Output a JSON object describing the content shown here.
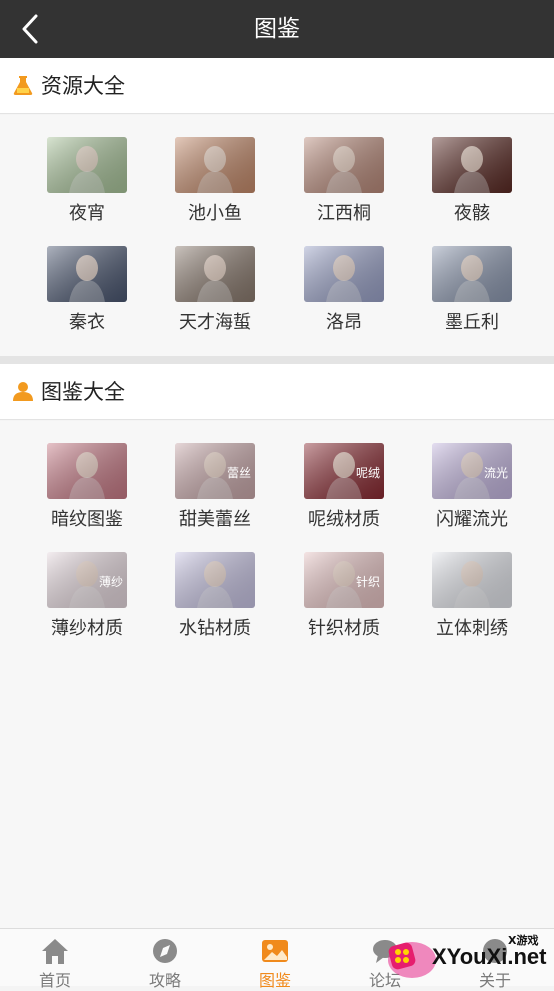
{
  "header": {
    "title": "图鉴"
  },
  "sections": [
    {
      "title": "资源大全",
      "items": [
        {
          "label": "夜宵",
          "tint": "#a9c49a"
        },
        {
          "label": "池小鱼",
          "tint": "#c48a6a"
        },
        {
          "label": "江西桐",
          "tint": "#b98a7a"
        },
        {
          "label": "夜骸",
          "tint": "#5a2a24"
        },
        {
          "label": "秦衣",
          "tint": "#4a5670"
        },
        {
          "label": "天才海蜇",
          "tint": "#8a7a6e"
        },
        {
          "label": "洛昂",
          "tint": "#9aa2c8"
        },
        {
          "label": "墨丘利",
          "tint": "#8c98b0"
        }
      ]
    },
    {
      "title": "图鉴大全",
      "items": [
        {
          "label": "暗纹图鉴",
          "tint": "#c87a86",
          "overlay": ""
        },
        {
          "label": "甜美蕾丝",
          "tint": "#c9a8aa",
          "overlay": "蕾丝"
        },
        {
          "label": "呢绒材质",
          "tint": "#8a2a32",
          "overlay": "呢绒"
        },
        {
          "label": "闪耀流光",
          "tint": "#c4b6e0",
          "overlay": "流光"
        },
        {
          "label": "薄纱材质",
          "tint": "#e6d8de",
          "overlay": "薄纱"
        },
        {
          "label": "水钻材质",
          "tint": "#c8c4e4",
          "overlay": ""
        },
        {
          "label": "针织材质",
          "tint": "#e8c4c4",
          "overlay": "针织"
        },
        {
          "label": "立体刺绣",
          "tint": "#e2e4ea",
          "overlay": ""
        }
      ]
    }
  ],
  "tabbar": {
    "tabs": [
      {
        "label": "首页",
        "icon": "home-icon"
      },
      {
        "label": "攻略",
        "icon": "compass-icon"
      },
      {
        "label": "图鉴",
        "icon": "image-icon",
        "active": true
      },
      {
        "label": "论坛",
        "icon": "chat-icon"
      },
      {
        "label": "关于",
        "icon": "info-icon"
      }
    ]
  },
  "watermark": {
    "text": "XYouXi.net",
    "small": "X游戏"
  },
  "colors": {
    "header_bg": "#333333",
    "accent": "#f08a1c"
  }
}
